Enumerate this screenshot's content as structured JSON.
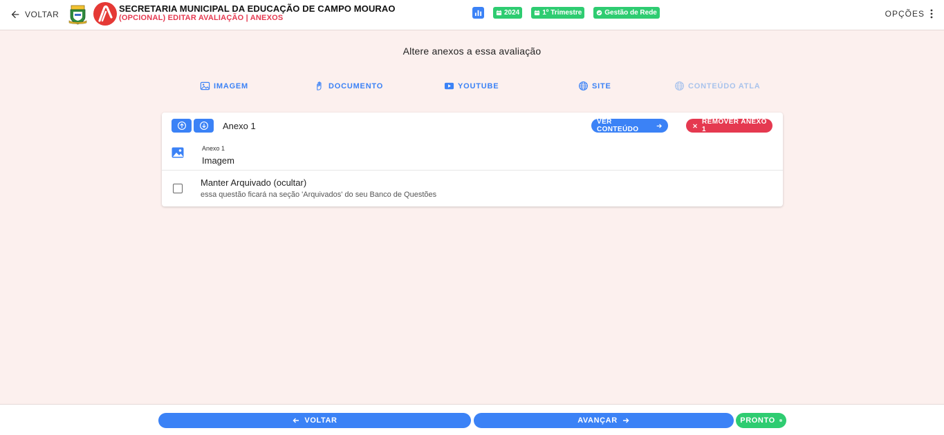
{
  "header": {
    "back_label": "VOLTAR",
    "title": "SECRETARIA MUNICIPAL DA EDUCAÇÃO DE CAMPO MOURAO",
    "subtitle": "(OPCIONAL) EDITAR AVALIAÇÃO | ANEXOS",
    "chips": {
      "year": "2024",
      "period": "1º Trimestre",
      "scope": "Gestão de Rede"
    },
    "options_label": "OPÇÕES"
  },
  "main": {
    "heading": "Altere anexos a essa avaliação",
    "tabs": {
      "image": "IMAGEM",
      "document": "DOCUMENTO",
      "youtube": "YOUTUBE",
      "site": "SITE",
      "atla": "CONTEÚDO ATLA"
    },
    "attachment": {
      "title": "Anexo 1",
      "view_label": "VER CONTEÚDO",
      "remove_label": "REMOVER ANEXO 1",
      "type_field_label": "Anexo 1",
      "type_field_value": "Imagem",
      "archive_label": "Manter Arquivado (ocultar)",
      "archive_help": "essa questão ficará na seção 'Arquivados' do seu Banco de Questões",
      "archived": false
    }
  },
  "footer": {
    "back_label": "VOLTAR",
    "next_label": "AVANÇAR",
    "ready_label": "PRONTO"
  },
  "colors": {
    "primary": "#3b82f6",
    "success": "#2ecc71",
    "danger": "#e53950",
    "background": "#fcf0ee"
  }
}
